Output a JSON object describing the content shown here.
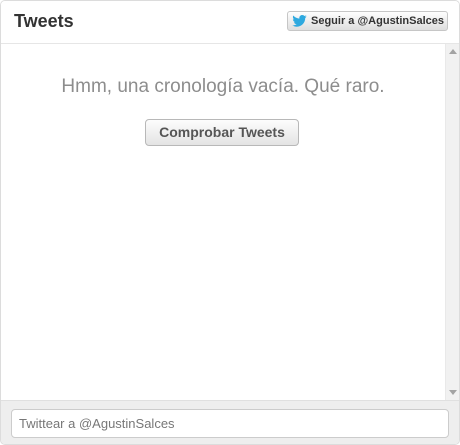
{
  "header": {
    "title": "Tweets",
    "follow_label": "Seguir a @AgustinSalces"
  },
  "timeline": {
    "empty_message": "Hmm, una cronología vacía. Qué raro.",
    "check_button_label": "Comprobar Tweets"
  },
  "composer": {
    "placeholder": "Twittear a @AgustinSalces"
  },
  "colors": {
    "twitter_blue": "#2ea9df"
  }
}
